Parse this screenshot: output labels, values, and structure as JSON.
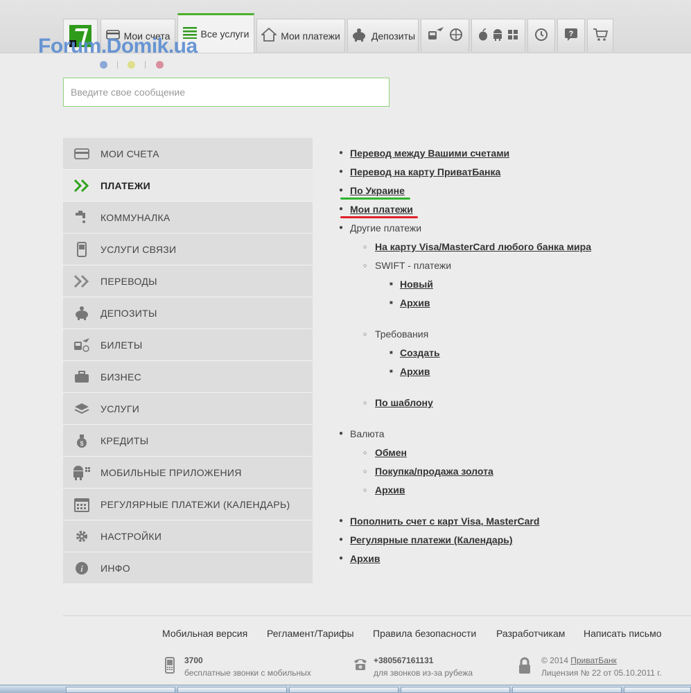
{
  "header": {
    "tabs": [
      {
        "name": "my-accounts",
        "label": "Мои счета",
        "icon": "card-icon"
      },
      {
        "name": "all-services",
        "label": "Все услуги",
        "icon": "list-icon",
        "active": true
      },
      {
        "name": "my-payments",
        "label": "Мои платежи",
        "icon": "house-icon"
      },
      {
        "name": "deposits",
        "label": "Депозиты",
        "icon": "piggy-icon"
      }
    ],
    "watermark": "Forum.Domik.ua"
  },
  "message_input": {
    "placeholder": "Введите свое сообщение",
    "value": ""
  },
  "sidebar": {
    "items": [
      {
        "label": "МОИ СЧЕТА",
        "icon": "card-icon"
      },
      {
        "label": "ПЛАТЕЖИ",
        "icon": "double-chevron-icon",
        "active": true
      },
      {
        "label": "КОММУНАЛКА",
        "icon": "faucet-icon"
      },
      {
        "label": "УСЛУГИ СВЯЗИ",
        "icon": "phone-icon"
      },
      {
        "label": "ПЕРЕВОДЫ",
        "icon": "double-chevron-icon"
      },
      {
        "label": "ДЕПОЗИТЫ",
        "icon": "piggy-icon"
      },
      {
        "label": "БИЛЕТЫ",
        "icon": "train-plane-icon"
      },
      {
        "label": "БИЗНЕС",
        "icon": "briefcase-icon"
      },
      {
        "label": "УСЛУГИ",
        "icon": "layers-icon"
      },
      {
        "label": "КРЕДИТЫ",
        "icon": "moneybag-icon"
      },
      {
        "label": "МОБИЛЬНЫЕ ПРИЛОЖЕНИЯ",
        "icon": "android-icon"
      },
      {
        "label": "РЕГУЛЯРНЫЕ ПЛАТЕЖИ (КАЛЕНДАРЬ)",
        "icon": "calendar-icon"
      },
      {
        "label": "НАСТРОЙКИ",
        "icon": "gear-icon"
      },
      {
        "label": "ИНФО",
        "icon": "info-icon"
      }
    ]
  },
  "content": {
    "transfer_own": "Перевод между Вашими счетами",
    "transfer_card": "Перевод на карту ПриватБанка",
    "ukraine": "По Украине",
    "my_payments": "Мои платежи",
    "other": "Другие платежи",
    "visa_any": "На карту Visa/MasterCard любого банка мира",
    "swift": "SWIFT - платежи",
    "swift_new": "Новый",
    "swift_archive": "Архив",
    "requirements": "Требования",
    "req_create": "Создать",
    "req_archive": "Архив",
    "by_template": "По шаблону",
    "currency": "Валюта",
    "exchange": "Обмен",
    "gold": "Покупка/продажа золота",
    "cur_archive": "Архив",
    "topup": "Пополнить счет с карт Visa, MasterCard",
    "regular": "Регулярные платежи (Календарь)",
    "archive": "Архив",
    "underline_colors": {
      "ukraine": "#2fb52f",
      "my_payments": "#e0202a"
    }
  },
  "footer": {
    "links": [
      "Мобильная версия",
      "Регламент/Тарифы",
      "Правила безопасности",
      "Разработчикам",
      "Написать письмо"
    ],
    "phone1": {
      "number": "3700",
      "note": "бесплатные звонки с мобильных"
    },
    "phone2": {
      "number": "+380567161131",
      "note": "для звонков из-за рубежа"
    },
    "copyright_prefix": "© 2014",
    "bank": "ПриватБанк",
    "license": "Лицензия № 22 от 05.10.2011 г."
  }
}
